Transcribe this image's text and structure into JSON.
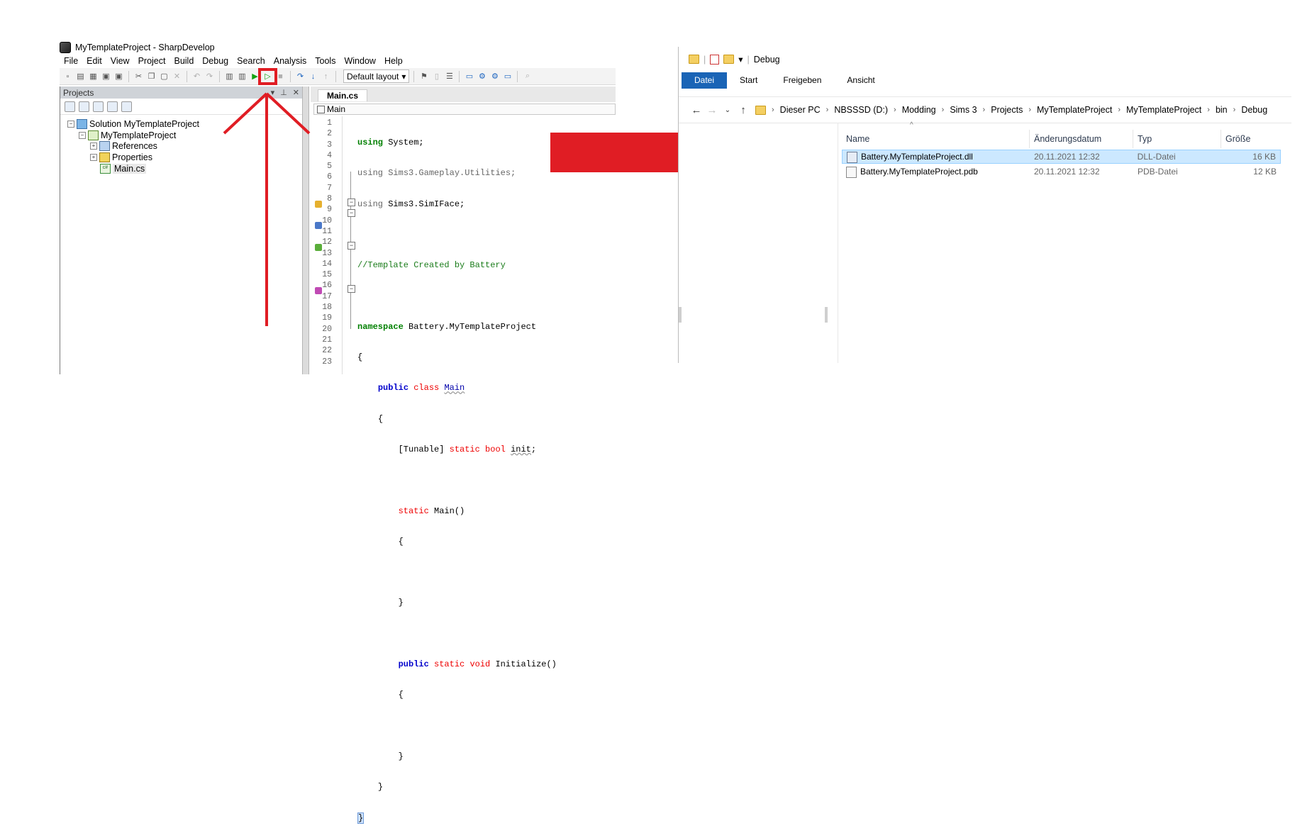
{
  "sharpdevelop": {
    "title": "MyTemplateProject - SharpDevelop",
    "menu": [
      "File",
      "Edit",
      "View",
      "Project",
      "Build",
      "Debug",
      "Search",
      "Analysis",
      "Tools",
      "Window",
      "Help"
    ],
    "layout_select": "Default layout",
    "projects_pad": {
      "title": "Projects",
      "tree": {
        "solution": "Solution MyTemplateProject",
        "project": "MyTemplateProject",
        "references": "References",
        "properties": "Properties",
        "file": "Main.cs"
      }
    },
    "editor": {
      "tab": "Main.cs",
      "nav_class": "Main",
      "line_numbers": [
        "1",
        "2",
        "3",
        "4",
        "5",
        "6",
        "7",
        "8",
        "9",
        "10",
        "11",
        "12",
        "13",
        "14",
        "15",
        "16",
        "17",
        "18",
        "19",
        "20",
        "21",
        "22",
        "23"
      ],
      "code": {
        "l1_kw": "using",
        "l1_rest": " System;",
        "l2_kw": "using",
        "l2_rest": " Sims3.Gameplay.Utilities;",
        "l3_kw": "using",
        "l3_rest": " Sims3.SimIFace;",
        "l5": "//Template Created by Battery",
        "l7_kw": "namespace",
        "l7_rest": " Battery.MyTemplateProject",
        "l8": "{",
        "l9_kw1": "public",
        "l9_kw2": "class",
        "l9_name": "Main",
        "l10": "{",
        "l11_attr": "[Tunable]",
        "l11_kw1": "static",
        "l11_kw2": "bool",
        "l11_name": "init",
        "l13_kw": "static",
        "l13_rest": " Main()",
        "l14": "{",
        "l16": "}",
        "l18_kw1": "public",
        "l18_kw2": "static",
        "l18_kw3": "void",
        "l18_name": "Initialize()",
        "l19": "{",
        "l21": "}",
        "l22": "}",
        "l23": "}"
      }
    }
  },
  "explorer": {
    "title": "Debug",
    "ribbon": [
      "Datei",
      "Start",
      "Freigeben",
      "Ansicht"
    ],
    "breadcrumb": [
      "Dieser PC",
      "NBSSSD (D:)",
      "Modding",
      "Sims 3",
      "Projects",
      "MyTemplateProject",
      "MyTemplateProject",
      "bin",
      "Debug"
    ],
    "columns": [
      "Name",
      "Änderungsdatum",
      "Typ",
      "Größe"
    ],
    "files": [
      {
        "name": "Battery.MyTemplateProject.dll",
        "date": "20.11.2021 12:32",
        "type": "DLL-Datei",
        "size": "16 KB"
      },
      {
        "name": "Battery.MyTemplateProject.pdb",
        "date": "20.11.2021 12:32",
        "type": "PDB-Datei",
        "size": "12 KB"
      }
    ]
  },
  "colors": {
    "annotation_red": "#e01d24",
    "ribbon_blue": "#1a64b6",
    "selection_blue": "#cce8ff"
  }
}
